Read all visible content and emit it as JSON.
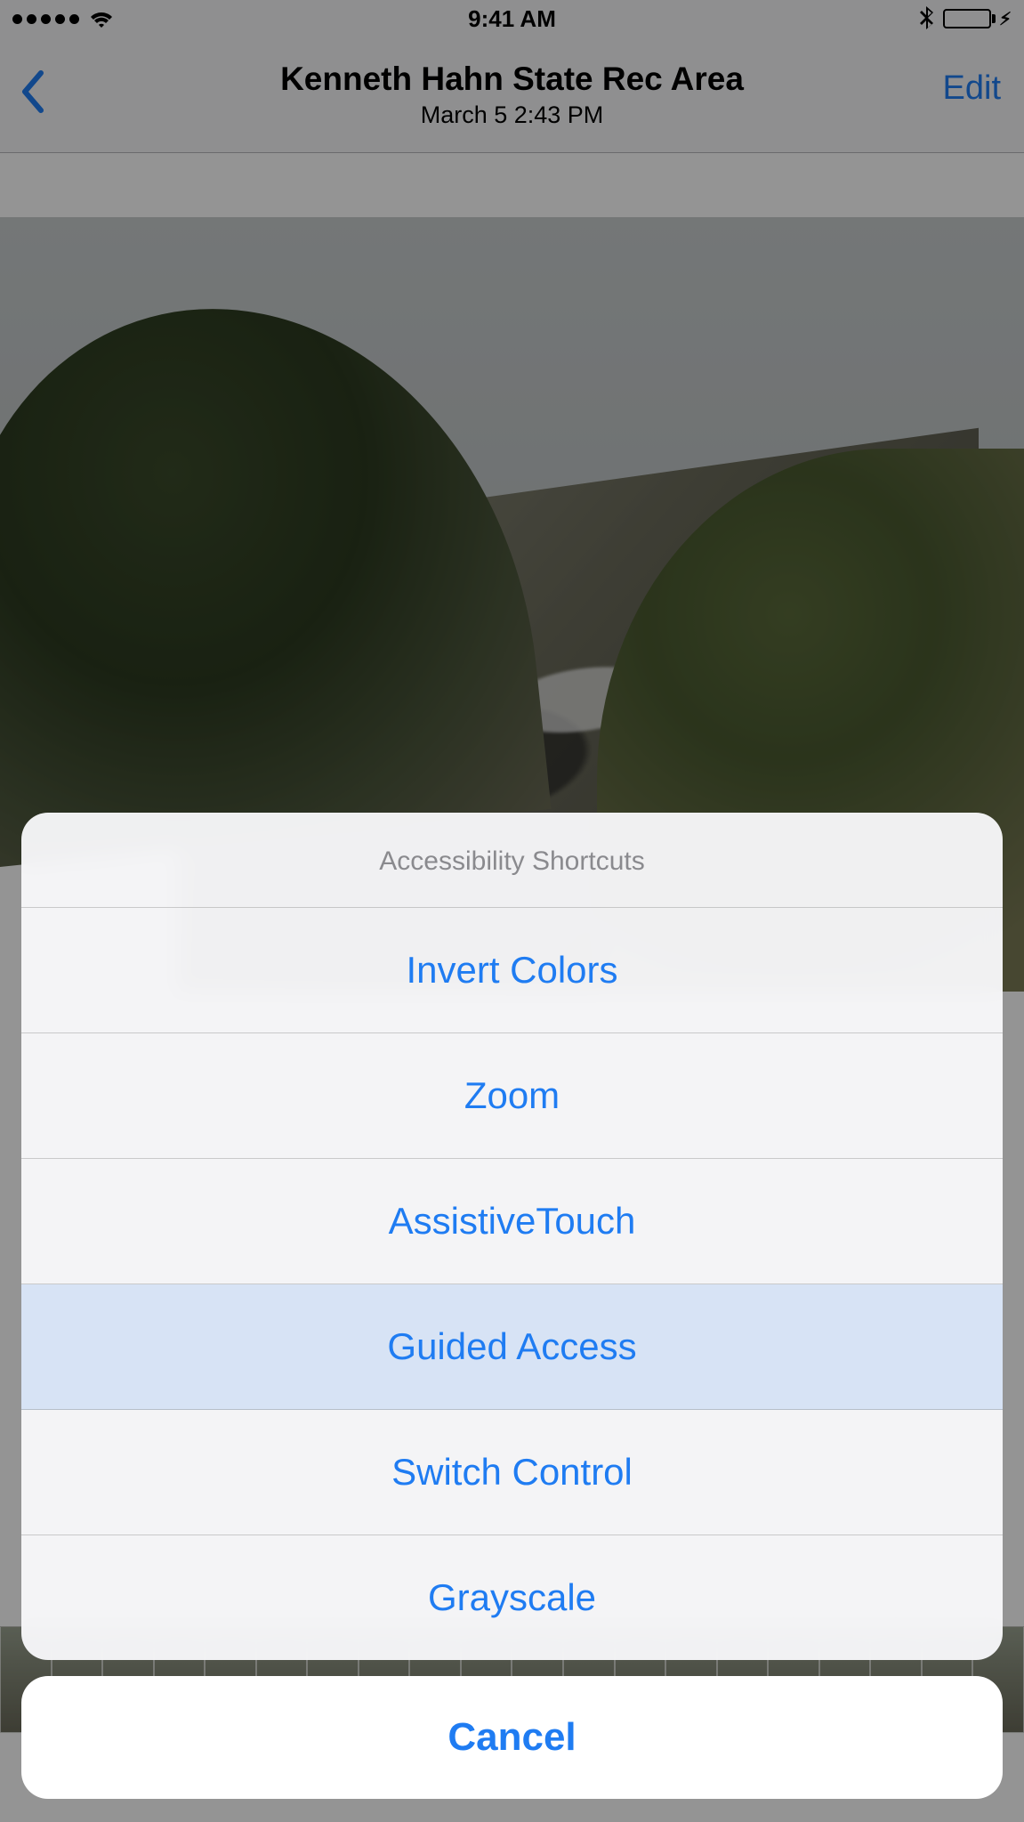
{
  "status": {
    "time": "9:41 AM",
    "signal_dots": 5,
    "bluetooth": true,
    "battery_color": "#35c759"
  },
  "nav": {
    "title": "Kenneth Hahn State Rec Area",
    "subtitle": "March 5  2:43 PM",
    "edit_label": "Edit"
  },
  "action_sheet": {
    "title": "Accessibility Shortcuts",
    "items": [
      {
        "label": "Invert Colors",
        "highlighted": false
      },
      {
        "label": "Zoom",
        "highlighted": false
      },
      {
        "label": "AssistiveTouch",
        "highlighted": false
      },
      {
        "label": "Guided Access",
        "highlighted": true
      },
      {
        "label": "Switch Control",
        "highlighted": false
      },
      {
        "label": "Grayscale",
        "highlighted": false
      }
    ],
    "cancel_label": "Cancel"
  }
}
